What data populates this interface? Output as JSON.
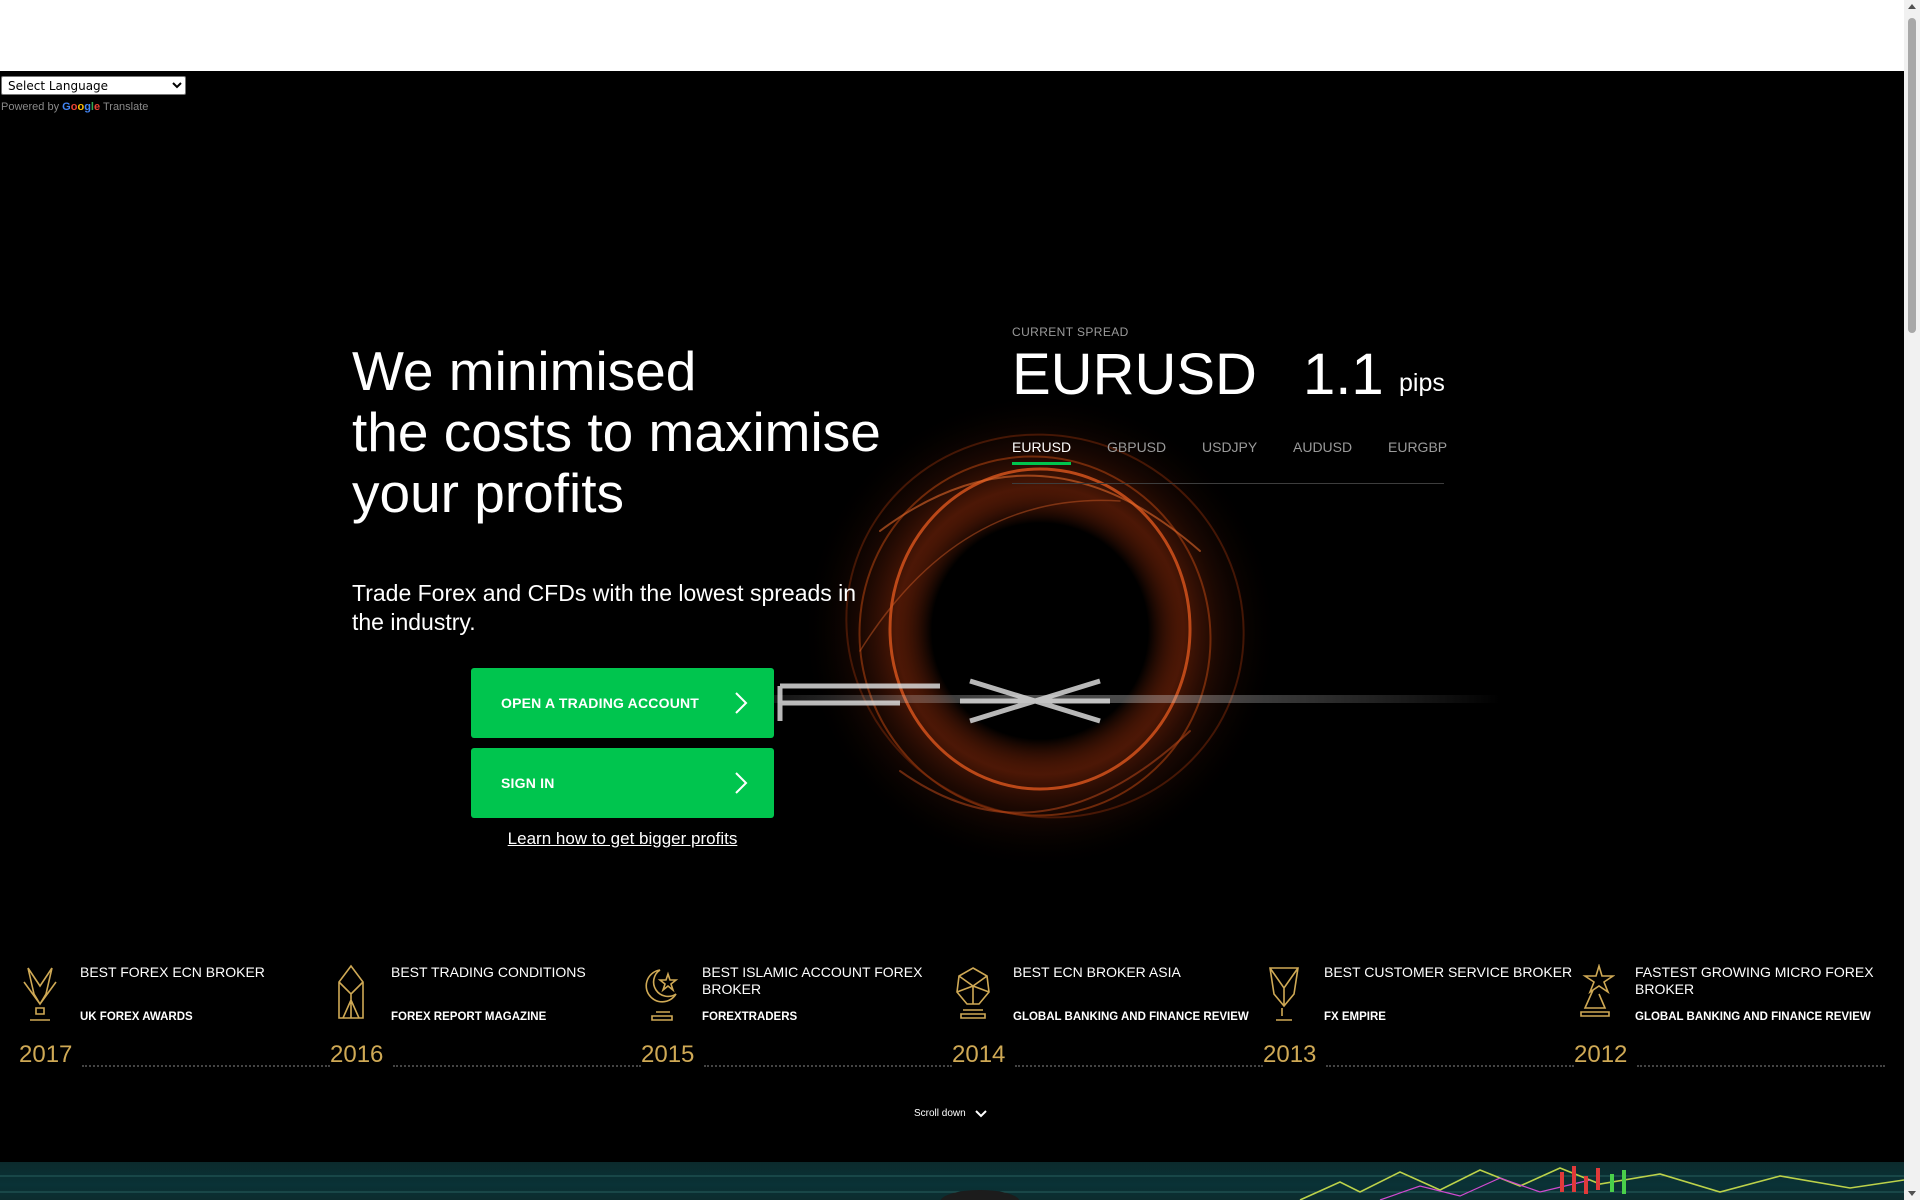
{
  "translate": {
    "select_label": "Select Language",
    "powered_by": "Powered by",
    "google": "Google",
    "translate_link": "Translate"
  },
  "hero": {
    "headline_lines": [
      "We minimised",
      "the costs to maximise",
      "your profits"
    ],
    "subhead": "Trade Forex and CFDs with the lowest spreads in the industry.",
    "open_account_label": "OPEN A TRADING ACCOUNT",
    "sign_in_label": "SIGN IN",
    "learn_link": "Learn how to get bigger profits"
  },
  "spread": {
    "label": "CURRENT SPREAD",
    "pair": "EURUSD",
    "value": "1.1",
    "unit": "pips",
    "tabs": [
      "EURUSD",
      "GBPUSD",
      "USDJPY",
      "AUDUSD",
      "EURGBP"
    ],
    "active_tab": "EURUSD"
  },
  "awards": [
    {
      "title": "BEST FOREX ECN BROKER",
      "source": "UK FOREX AWARDS",
      "year": "2017",
      "icon": "trophy-icon"
    },
    {
      "title": "BEST TRADING CONDITIONS",
      "source": "FOREX REPORT MAGAZINE",
      "year": "2016",
      "icon": "crystal-trophy-icon"
    },
    {
      "title": "BEST ISLAMIC ACCOUNT FOREX BROKER",
      "source": "FOREXTRADERS",
      "year": "2015",
      "icon": "crescent-star-trophy-icon"
    },
    {
      "title": "BEST ECN BROKER ASIA",
      "source": "GLOBAL BANKING AND FINANCE REVIEW",
      "year": "2014",
      "icon": "globe-trophy-icon"
    },
    {
      "title": "BEST CUSTOMER SERVICE BROKER",
      "source": "FX EMPIRE",
      "year": "2013",
      "icon": "shield-trophy-icon"
    },
    {
      "title": "FASTEST GROWING MICRO FOREX BROKER",
      "source": "GLOBAL BANKING AND FINANCE REVIEW",
      "year": "2012",
      "icon": "star-trophy-icon"
    }
  ],
  "scroll_down": "Scroll down",
  "colors": {
    "accent_green": "#00c54e",
    "award_gold": "#cfa955",
    "background": "#000000"
  }
}
